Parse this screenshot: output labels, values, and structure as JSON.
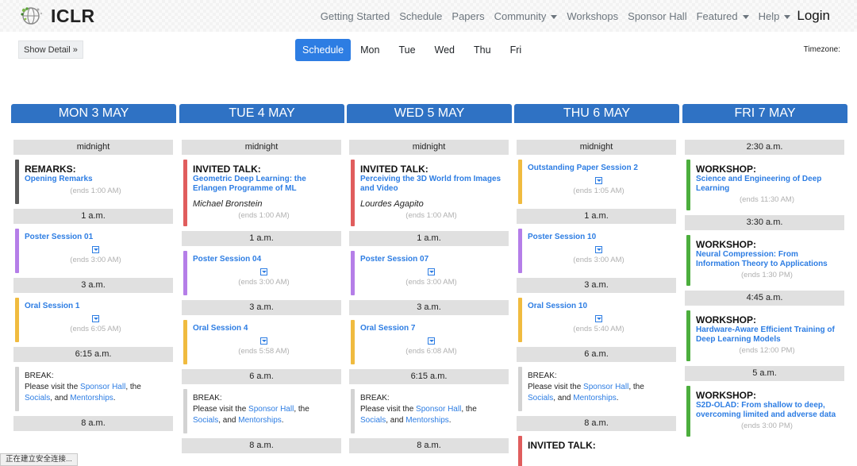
{
  "brand": {
    "name": "ICLR",
    "logo_icon": "iclr-globe-icon"
  },
  "nav": {
    "items": [
      {
        "label": "Getting Started",
        "dropdown": false
      },
      {
        "label": "Schedule",
        "dropdown": false
      },
      {
        "label": "Papers",
        "dropdown": false
      },
      {
        "label": "Community",
        "dropdown": true
      },
      {
        "label": "Workshops",
        "dropdown": false
      },
      {
        "label": "Sponsor Hall",
        "dropdown": false
      },
      {
        "label": "Featured",
        "dropdown": true
      },
      {
        "label": "Help",
        "dropdown": true
      }
    ],
    "login": "Login"
  },
  "toolbar": {
    "show_detail": "Show Detail »",
    "day_tabs": [
      "Schedule",
      "Mon",
      "Tue",
      "Wed",
      "Thu",
      "Fri"
    ],
    "active_tab": "Schedule",
    "timezone_label": "Timezone:"
  },
  "break_text": {
    "prefix": "BREAK:",
    "line1": "Please visit the ",
    "sponsor": "Sponsor Hall",
    "the": ", the",
    "socials": "Socials",
    "and": ", and ",
    "mentorships": "Mentorships",
    "end": "."
  },
  "colors": {
    "remarks": "#5a5a5a",
    "invited": "#e05d5d",
    "poster": "#b57ee8",
    "oral": "#f0bb3f",
    "workshop": "#4cae3d",
    "break": "#d3d3d3",
    "header": "#2f72c4",
    "link": "#2d7de3"
  },
  "days": [
    {
      "header": "MON 3 MAY",
      "slots": [
        {
          "type": "time",
          "label": "midnight"
        },
        {
          "type": "event",
          "color": "remarks",
          "kind": "REMARKS:",
          "title": "Opening Remarks",
          "ends": "(ends 1:00 AM)"
        },
        {
          "type": "time",
          "label": "1 a.m."
        },
        {
          "type": "event",
          "color": "poster",
          "title": "Poster Session 01",
          "expand": true,
          "ends": "(ends 3:00 AM)"
        },
        {
          "type": "time",
          "label": "3 a.m."
        },
        {
          "type": "event",
          "color": "oral",
          "title": "Oral Session 1",
          "expand": true,
          "ends": "(ends 6:05 AM)"
        },
        {
          "type": "time",
          "label": "6:15 a.m."
        },
        {
          "type": "break"
        },
        {
          "type": "time",
          "label": "8 a.m."
        }
      ]
    },
    {
      "header": "TUE 4 MAY",
      "slots": [
        {
          "type": "time",
          "label": "midnight"
        },
        {
          "type": "event",
          "color": "invited",
          "kind": "INVITED TALK:",
          "title": "Geometric Deep Learning: the Erlangen Programme of ML",
          "speaker": "Michael Bronstein",
          "ends": "(ends 1:00 AM)"
        },
        {
          "type": "time",
          "label": "1 a.m."
        },
        {
          "type": "event",
          "color": "poster",
          "title": "Poster Session 04",
          "expand": true,
          "ends": "(ends 3:00 AM)"
        },
        {
          "type": "time",
          "label": "3 a.m."
        },
        {
          "type": "event",
          "color": "oral",
          "title": "Oral Session 4",
          "expand": true,
          "ends": "(ends 5:58 AM)"
        },
        {
          "type": "time",
          "label": "6 a.m."
        },
        {
          "type": "break"
        },
        {
          "type": "time",
          "label": "8 a.m."
        }
      ]
    },
    {
      "header": "WED 5 MAY",
      "slots": [
        {
          "type": "time",
          "label": "midnight"
        },
        {
          "type": "event",
          "color": "invited",
          "kind": "INVITED TALK:",
          "title": "Perceiving the 3D World from Images and Video",
          "speaker": "Lourdes Agapito",
          "ends": "(ends 1:00 AM)"
        },
        {
          "type": "time",
          "label": "1 a.m."
        },
        {
          "type": "event",
          "color": "poster",
          "title": "Poster Session 07",
          "expand": true,
          "ends": "(ends 3:00 AM)"
        },
        {
          "type": "time",
          "label": "3 a.m."
        },
        {
          "type": "event",
          "color": "oral",
          "title": "Oral Session 7",
          "expand": true,
          "ends": "(ends 6:08 AM)"
        },
        {
          "type": "time",
          "label": "6:15 a.m."
        },
        {
          "type": "break"
        },
        {
          "type": "time",
          "label": "8 a.m."
        }
      ]
    },
    {
      "header": "THU 6 MAY",
      "slots": [
        {
          "type": "time",
          "label": "midnight"
        },
        {
          "type": "event",
          "color": "oral",
          "title": "Outstanding Paper Session 2",
          "expand": true,
          "ends": "(ends 1:05 AM)"
        },
        {
          "type": "time",
          "label": "1 a.m."
        },
        {
          "type": "event",
          "color": "poster",
          "title": "Poster Session 10",
          "expand": true,
          "ends": "(ends 3:00 AM)"
        },
        {
          "type": "time",
          "label": "3 a.m."
        },
        {
          "type": "event",
          "color": "oral",
          "title": "Oral Session 10",
          "expand": true,
          "ends": "(ends 5:40 AM)"
        },
        {
          "type": "time",
          "label": "6 a.m."
        },
        {
          "type": "break"
        },
        {
          "type": "time",
          "label": "8 a.m."
        },
        {
          "type": "event",
          "color": "invited",
          "kind": "INVITED TALK:",
          "title": "",
          "ends": ""
        }
      ]
    },
    {
      "header": "FRI 7 MAY",
      "slots": [
        {
          "type": "time",
          "label": "2:30 a.m."
        },
        {
          "type": "event",
          "color": "workshop",
          "kind": "WORKSHOP:",
          "title": "Science and Engineering of Deep Learning",
          "ends": "(ends 11:30 AM)"
        },
        {
          "type": "time",
          "label": "3:30 a.m."
        },
        {
          "type": "event",
          "color": "workshop",
          "kind": "WORKSHOP:",
          "title": "Neural Compression: From Information Theory to Applications",
          "ends": "(ends 1:30 PM)"
        },
        {
          "type": "time",
          "label": "4:45 a.m."
        },
        {
          "type": "event",
          "color": "workshop",
          "kind": "WORKSHOP:",
          "title": "Hardware-Aware Efficient Training of Deep Learning Models",
          "ends": "(ends 12:00 PM)"
        },
        {
          "type": "time",
          "label": "5 a.m."
        },
        {
          "type": "event",
          "color": "workshop",
          "kind": "WORKSHOP:",
          "title": "S2D-OLAD: From shallow to deep, overcoming limited and adverse data",
          "ends": "(ends 3:00 PM)"
        }
      ]
    }
  ],
  "status_bar": "正在建立安全连接..."
}
